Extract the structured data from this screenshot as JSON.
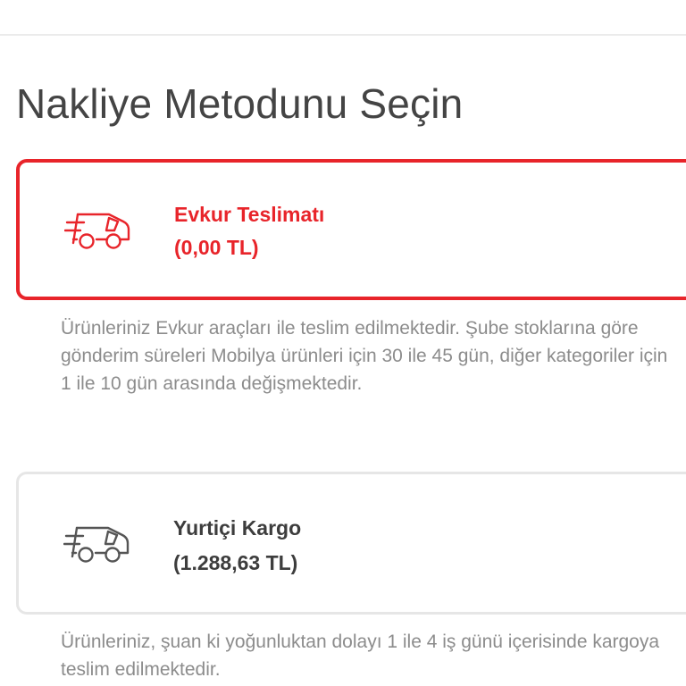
{
  "page": {
    "title": "Nakliye Metodunu Seçin"
  },
  "options": [
    {
      "name": "Evkur Teslimatı",
      "price": "(0,00 TL)",
      "icon": "delivery-truck-icon",
      "selected": true,
      "description": "Ürünleriniz Evkur araçları ile teslim edilmektedir. Şube stoklarına göre gönderim süreleri Mobilya ürünleri için 30 ile 45 gün, diğer kategoriler için 1 ile 10 gün arasında değişmektedir."
    },
    {
      "name": "Yurtiçi Kargo",
      "price": "(1.288,63 TL)",
      "icon": "delivery-truck-icon",
      "selected": false,
      "description": "Ürünleriniz, şuan ki yoğunluktan dolayı 1 ile 4 iş günü içerisinde kargoya teslim edilmektedir."
    }
  ],
  "colors": {
    "accent": "#e8242a",
    "text_dark": "#3d3d3d",
    "text_muted": "#8c8c8c",
    "border_inactive": "#e6e6e6"
  }
}
